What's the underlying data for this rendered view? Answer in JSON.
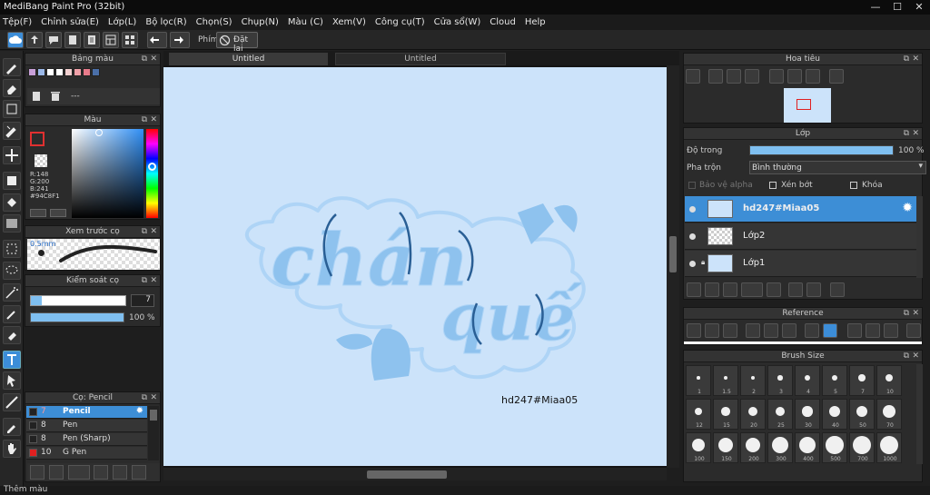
{
  "window": {
    "title": "MediBang Paint Pro (32bit)",
    "minimize": "—",
    "maximize": "☐",
    "close": "✕"
  },
  "menu": [
    "Tệp(F)",
    "Chỉnh sửa(E)",
    "Lớp(L)",
    "Bộ lọc(R)",
    "Chọn(S)",
    "Chụp(N)",
    "Màu (C)",
    "Xem(V)",
    "Công cụ(T)",
    "Cửa sổ(W)",
    "Cloud",
    "Help"
  ],
  "toolbar": {
    "shortcut_label": "Phím",
    "reset_label": "Đặt lại"
  },
  "tabs": [
    "Untitled",
    "Untitled"
  ],
  "palette_panel": {
    "title": "Bảng màu",
    "empty_label": "---",
    "colors": [
      "#c8a0d8",
      "#9bb8e8",
      "#ffffff",
      "#ffffff",
      "#f2d0d0",
      "#f0a0a8",
      "#e87a8a",
      "#4a6fa8"
    ]
  },
  "color_panel": {
    "title": "Màu",
    "r": "R:148",
    "g": "G:200",
    "b": "B:241",
    "hex": "#94C8F1",
    "primary": "#94C8F1"
  },
  "preview_panel": {
    "title": "Xem trước cọ",
    "size": "0.5mm"
  },
  "brush_control": {
    "title": "Kiểm soát cọ",
    "size": "7",
    "opacity": "100 %"
  },
  "brush_panel": {
    "title": "Cọ: Pencil",
    "items": [
      {
        "num": "7",
        "name": "Pencil",
        "color": "#222222"
      },
      {
        "num": "8",
        "name": "Pen",
        "color": "#222222"
      },
      {
        "num": "8",
        "name": "Pen (Sharp)",
        "color": "#222222"
      },
      {
        "num": "10",
        "name": "G Pen",
        "color": "#e02020"
      }
    ]
  },
  "navigator": {
    "title": "Hoa tiêu"
  },
  "layer_panel": {
    "title": "Lớp",
    "opacity_label": "Độ trong",
    "opacity_value": "100 %",
    "blend_label": "Pha trộn",
    "blend_value": "Bình thường",
    "protect_alpha": "Bảo vệ alpha",
    "clipping": "Xén bớt",
    "lock": "Khóa",
    "layers": [
      {
        "name": "hd247#Miaa05",
        "selected": true
      },
      {
        "name": "Lớp2",
        "selected": false
      },
      {
        "name": "Lớp1",
        "selected": false
      }
    ]
  },
  "reference_panel": {
    "title": "Reference"
  },
  "brush_size_panel": {
    "title": "Brush Size",
    "sizes": [
      "1",
      "1.5",
      "2",
      "3",
      "4",
      "5",
      "7",
      "10",
      "12",
      "15",
      "20",
      "25",
      "30",
      "40",
      "50",
      "70",
      "100",
      "150",
      "200",
      "300",
      "400",
      "500",
      "700",
      "1000"
    ]
  },
  "canvas": {
    "word1": "chán",
    "word2": "quế",
    "watermark": "hd247#Miaa05"
  },
  "status": {
    "text": "Thêm màu"
  },
  "colors": {
    "accent": "#3d8ed6",
    "canvas_bg": "#cce3fa",
    "lettering": "#8ec2ee",
    "outline": "#aed4f6",
    "ink": "#2a5f95"
  }
}
